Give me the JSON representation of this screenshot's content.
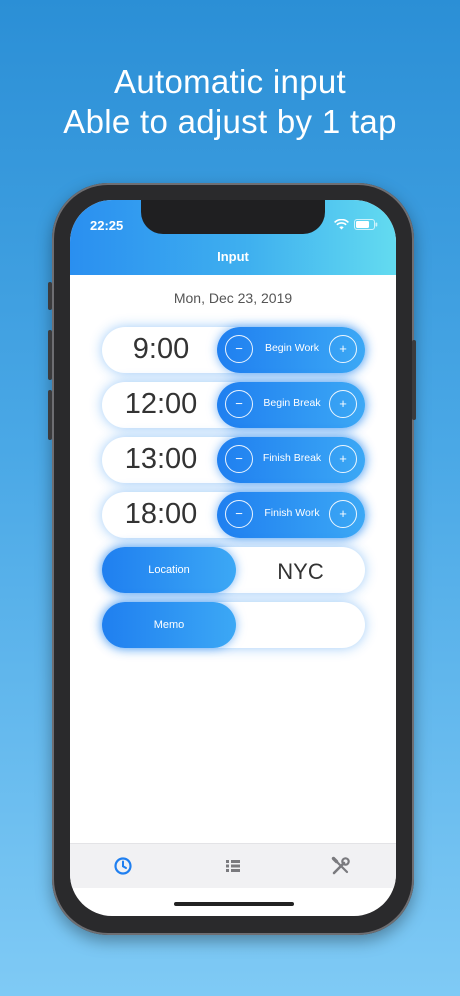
{
  "headline": {
    "line1": "Automatic input",
    "line2": "Able to adjust by 1 tap"
  },
  "status_bar": {
    "time": "22:25"
  },
  "header": {
    "title": "Input"
  },
  "date": "Mon, Dec 23, 2019",
  "time_rows": [
    {
      "time": "9:00",
      "label": "Begin Work",
      "minus": "−",
      "plus": "+"
    },
    {
      "time": "12:00",
      "label": "Begin Break",
      "minus": "−",
      "plus": "+"
    },
    {
      "time": "13:00",
      "label": "Finish Break",
      "minus": "−",
      "plus": "+"
    },
    {
      "time": "18:00",
      "label": "Finish Work",
      "minus": "−",
      "plus": "+"
    }
  ],
  "location": {
    "label": "Location",
    "value": "NYC"
  },
  "memo": {
    "label": "Memo",
    "value": ""
  },
  "tabs": [
    {
      "icon": "clock-icon",
      "active": true
    },
    {
      "icon": "list-icon",
      "active": false
    },
    {
      "icon": "tools-icon",
      "active": false
    }
  ],
  "colors": {
    "accent": "#2a8ff0",
    "tab_active": "#1f7ff0",
    "tab_inactive": "#7a7a7e"
  }
}
